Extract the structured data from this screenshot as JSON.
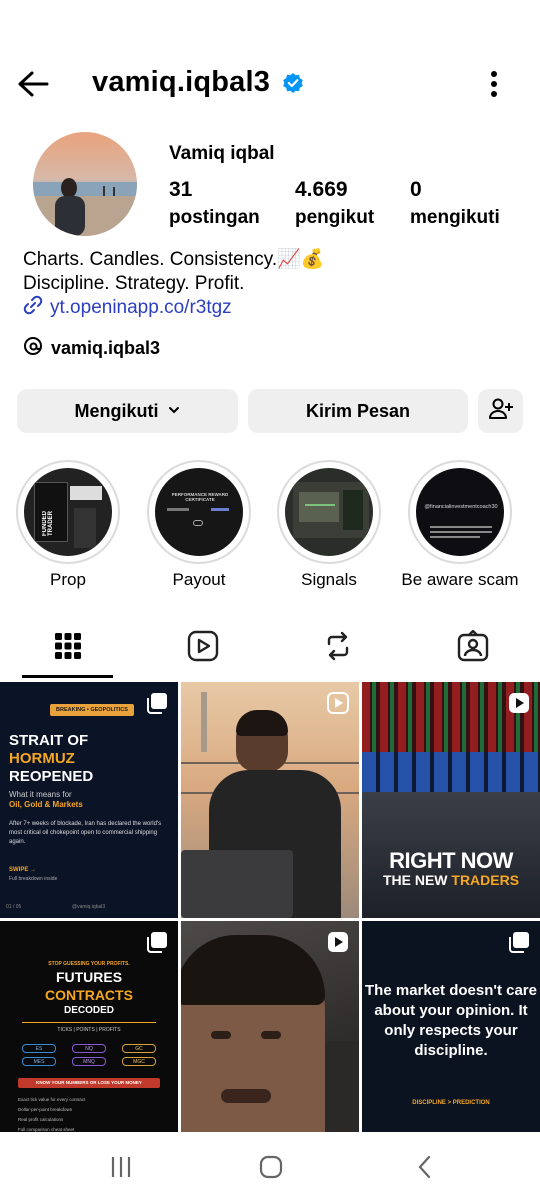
{
  "profile": {
    "username": "vamiq.iqbal3",
    "display_name": "Vamiq iqbal",
    "bio_line1": "Charts. Candles. Consistency.📈💰",
    "bio_line2": "Discipline. Strategy. Profit.",
    "link": "yt.openinapp.co/r3tgz",
    "threads": "vamiq.iqbal3"
  },
  "stats": [
    {
      "value": "31",
      "label": "postingan"
    },
    {
      "value": "4.669",
      "label": "pengikut"
    },
    {
      "value": "0",
      "label": "mengikuti"
    }
  ],
  "actions": {
    "following": "Mengikuti",
    "message": "Kirim Pesan"
  },
  "highlights": [
    {
      "label": "Prop",
      "inner": "FUNDED TRADER"
    },
    {
      "label": "Payout",
      "inner": "PERFORMANCE REWARD CERTIFICATE"
    },
    {
      "label": "Signals",
      "inner": ""
    },
    {
      "label": "Be aware scam",
      "inner": "@financialinvestmentcoach30"
    }
  ],
  "posts": {
    "p1": {
      "tag": "BREAKING • GEOPOLITICS",
      "l1": "STRAIT OF",
      "l2": "HORMUZ",
      "l3": "REOPENED",
      "sub": "What it means for",
      "sub2": "Oil, Gold & Markets",
      "body": "After 7+ weeks of blockade, Iran has declared the world's most critical oil chokepoint open to commercial shipping again.",
      "swipe": "SWIPE →",
      "swipe2": "Full breakdown inside",
      "page": "01 / 05",
      "handle": "@vamiq.iqbal3"
    },
    "p3": {
      "l1": "RIGHT NOW",
      "l2a": "THE NEW ",
      "l2b": "TRADERS"
    },
    "p4": {
      "top": "STOP GUESSING YOUR PROFITS.",
      "l1": "FUTURES",
      "l2": "CONTRACTS",
      "l3": "DECODED",
      "sub": "TICKS | POINTS | PROFITS",
      "chips": [
        "ES",
        "NQ",
        "GC",
        "MES",
        "MNQ",
        "MGC"
      ],
      "cta": "KNOW YOUR NUMBERS OR LOSE YOUR MONEY",
      "bullets": [
        "Exact tick value for every contract",
        "Dollar-per-point breakdown",
        "Real profit calculations",
        "Full comparison cheat sheet"
      ]
    },
    "p6": {
      "text": "The market doesn't care about your opinion. It only respects your discipline.",
      "foot": "DISCIPLINE > PREDICTION"
    }
  },
  "colors": {
    "link": "#2c3fbf",
    "verified": "#0095f6",
    "accent_gold": "#f5a623",
    "button_bg": "#efefef"
  }
}
